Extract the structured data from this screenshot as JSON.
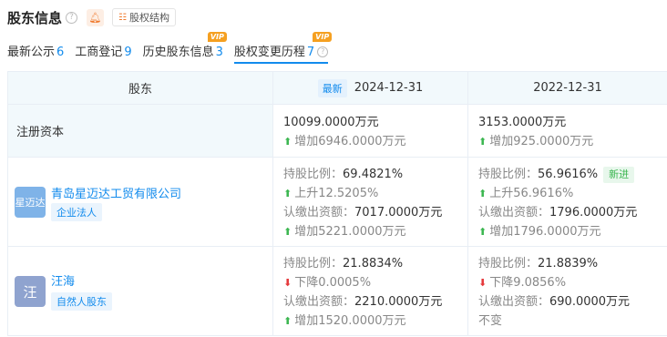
{
  "header": {
    "title": "股东信息",
    "equity_structure_label": "股权结构"
  },
  "tabs": [
    {
      "label": "最新公示",
      "count": "6"
    },
    {
      "label": "工商登记",
      "count": "9"
    },
    {
      "label": "历史股东信息",
      "count": "3"
    },
    {
      "label": "股权变更历程",
      "count": "7"
    }
  ],
  "vip_label": "VIP",
  "table": {
    "col_holder": "股东",
    "latest_tag": "最新",
    "dates": [
      "2024-12-31",
      "2022-12-31"
    ],
    "reg_capital_label": "注册资本",
    "reg_capital": [
      {
        "value": "10099.0000万元",
        "change": "增加6946.0000万元"
      },
      {
        "value": "3153.0000万元",
        "change": "增加925.0000万元"
      }
    ],
    "ratio_key": "持股比例：",
    "sub_key": "认缴出资额：",
    "rows": [
      {
        "avatar_text": "星迈达",
        "avatar_color": "#7fb3e8",
        "name": "青岛星迈达工贸有限公司",
        "tag": "企业法人",
        "periods": [
          {
            "ratio": "69.4821%",
            "ratio_change": "上升12.5205%",
            "sub": "7017.0000万元",
            "sub_change": "增加5221.0000万元",
            "badge": ""
          },
          {
            "ratio": "56.9616%",
            "ratio_change": "上升56.9616%",
            "sub": "1796.0000万元",
            "sub_change": "增加1796.0000万元",
            "badge": "新进"
          }
        ]
      },
      {
        "avatar_text": "汪",
        "avatar_color": "#8fa3cf",
        "name": "汪海",
        "tag": "自然人股东",
        "periods": [
          {
            "ratio": "21.8834%",
            "ratio_change": "下降0.0005%",
            "sub": "2210.0000万元",
            "sub_change": "增加1520.0000万元",
            "badge": ""
          },
          {
            "ratio": "21.8839%",
            "ratio_change": "下降9.0856%",
            "sub": "690.0000万元",
            "sub_change": "不变",
            "badge": ""
          }
        ]
      }
    ]
  }
}
